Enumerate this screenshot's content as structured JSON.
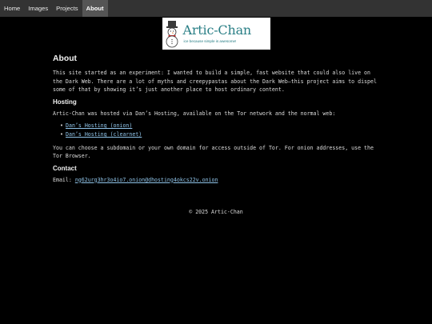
{
  "nav": {
    "items": [
      {
        "label": "Home"
      },
      {
        "label": "Images"
      },
      {
        "label": "Projects"
      },
      {
        "label": "About"
      }
    ],
    "active": "About"
  },
  "logo": {
    "title": "Artic-Chan",
    "tagline": "ice because simple is awesome!"
  },
  "main": {
    "heading": "About",
    "intro": "This site started as an experiment: I wanted to build a simple, fast website that could also live on the Dark Web. There are a lot of myths and creepypastas about the Dark Web—this project aims to dispel some of that by showing it’s just another place to host ordinary content.",
    "hosting": {
      "heading": "Hosting",
      "text": "Artic-Chan was hosted via Dan’s Hosting, available on the Tor network and the normal web:",
      "links": [
        {
          "label": "Dan’s Hosting (onion)"
        },
        {
          "label": "Dan’s Hosting (clearnet)"
        }
      ],
      "note": "You can choose a subdomain or your own domain for access outside of Tor. For onion addresses, use the Tor Browser."
    },
    "contact": {
      "heading": "Contact",
      "email_label": "Email:",
      "email": "ng62urg3hr3o4io7.onion@dhosting4okcs22v.onion"
    }
  },
  "footer": {
    "text": "© 2025 Artic-Chan"
  },
  "colors": {
    "background": "#000000",
    "navbar": "#333333",
    "nav_active": "#555555",
    "link": "#8fc3e8",
    "logo_teal": "#2a7f86"
  }
}
